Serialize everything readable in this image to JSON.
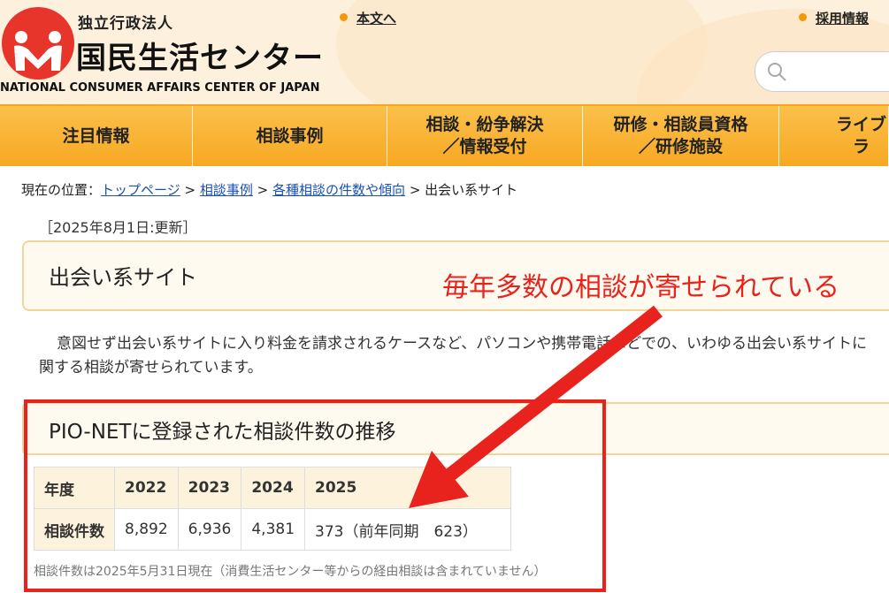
{
  "header": {
    "org_type": "独立行政法人",
    "org_name": "国民生活センター",
    "org_name_en": "NATIONAL CONSUMER AFFAIRS CENTER OF JAPAN",
    "skip_link": "本文へ",
    "recruit_link": "採用情報",
    "search_placeholder": ""
  },
  "nav": {
    "items": [
      {
        "label": "注目情報"
      },
      {
        "label": "相談事例"
      },
      {
        "label": "相談・紛争解決\n／情報受付"
      },
      {
        "label": "研修・相談員資格\n／研修施設"
      },
      {
        "label": "ライブラ"
      }
    ]
  },
  "breadcrumb": {
    "prefix": "現在の位置：",
    "links": [
      "トップページ",
      "相談事例",
      "各種相談の件数や傾向"
    ],
    "separator": ">",
    "current": "出会い系サイト"
  },
  "page": {
    "updated": "［2025年8月1日:更新］",
    "title": "出会い系サイト",
    "annotation": "毎年多数の相談が寄せられている",
    "intro": "意図せず出会い系サイトに入り料金を請求されるケースなど、パソコンや携帯電話などでの、いわゆる出会い系サイトに関する相談が寄せられています。",
    "section_title": "PIO-NETに登録された相談件数の推移",
    "note": "相談件数は2025年5月31日現在（消費生活センター等からの経由相談は含まれていません）"
  },
  "table": {
    "header_label": "年度",
    "row_label": "相談件数",
    "years": [
      "2022",
      "2023",
      "2024",
      "2025"
    ],
    "counts": [
      "8,892",
      "6,936",
      "4,381",
      "373（前年同期　623）"
    ]
  },
  "colors": {
    "accent_orange": "#f9b233",
    "annotation_red": "#e8221c",
    "link_blue": "#1a4fb8"
  }
}
